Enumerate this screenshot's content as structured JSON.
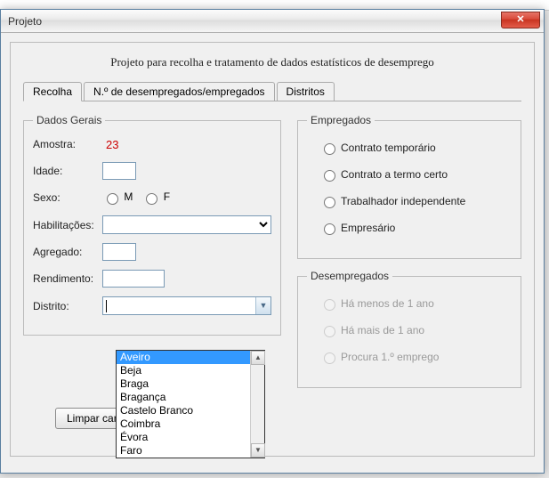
{
  "window": {
    "title": "Projeto",
    "close_glyph": "✕"
  },
  "heading": "Projeto para recolha e tratamento de dados estatísticos de desemprego",
  "tabs": [
    {
      "label": "Recolha",
      "active": true
    },
    {
      "label": "N.º de desempregados/empregados",
      "active": false
    },
    {
      "label": "Distritos",
      "active": false
    }
  ],
  "dados_gerais": {
    "legend": "Dados Gerais",
    "amostra_label": "Amostra:",
    "amostra_value": "23",
    "idade_label": "Idade:",
    "idade_value": "",
    "sexo_label": "Sexo:",
    "sexo_m": "M",
    "sexo_f": "F",
    "habilitacoes_label": "Habilitações:",
    "habilitacoes_value": "",
    "agregado_label": "Agregado:",
    "agregado_value": "",
    "rendimento_label": "Rendimento:",
    "rendimento_value": "",
    "distrito_label": "Distrito:",
    "distrito_value": "",
    "distrito_options": [
      "Aveiro",
      "Beja",
      "Braga",
      "Bragança",
      "Castelo Branco",
      "Coimbra",
      "Évora",
      "Faro"
    ]
  },
  "empregados": {
    "legend": "Empregados",
    "opt1": "Contrato temporário",
    "opt2": "Contrato a termo certo",
    "opt3": "Trabalhador independente",
    "opt4": "Empresário"
  },
  "desempregados": {
    "legend": "Desempregados",
    "opt1": "Há menos de 1 ano",
    "opt2": "Há mais de 1 ano",
    "opt3": "Procura 1.º emprego"
  },
  "buttons": {
    "limpar": "Limpar cam"
  }
}
